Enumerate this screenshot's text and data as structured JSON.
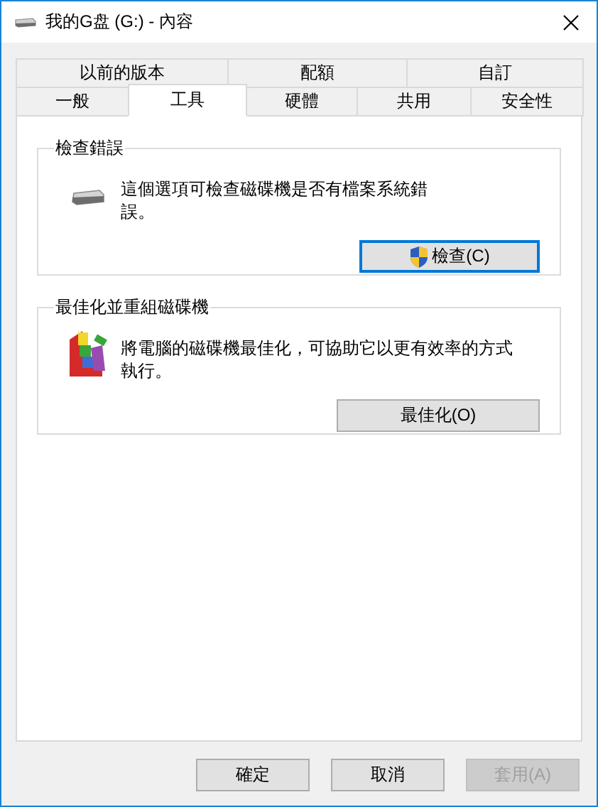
{
  "window": {
    "title": "我的G盘 (G:) - 內容"
  },
  "tab_rows": [
    [
      {
        "label": "以前的版本",
        "selected": false
      },
      {
        "label": "配額",
        "selected": false
      },
      {
        "label": "自訂",
        "selected": false
      }
    ],
    [
      {
        "label": "一般",
        "selected": false
      },
      {
        "label": "工具",
        "selected": true
      },
      {
        "label": "硬體",
        "selected": false
      },
      {
        "label": "共用",
        "selected": false
      },
      {
        "label": "安全性",
        "selected": false
      }
    ]
  ],
  "groups": [
    {
      "title": "檢查錯誤",
      "kind": "drive",
      "text": "這個選項可檢查磁碟機是否有檔案系統錯誤。",
      "button": {
        "label": "檢查(C)",
        "shield": true,
        "focused": true
      }
    },
    {
      "title": "最佳化並重組磁碟機",
      "kind": "defrag",
      "text": "將電腦的磁碟機最佳化，可協助它以更有效率的方式執行。",
      "button": {
        "label": "最佳化(O)",
        "shield": false,
        "focused": false
      }
    }
  ],
  "buttons": [
    {
      "label": "確定",
      "disabled": false
    },
    {
      "label": "取消",
      "disabled": false
    },
    {
      "label": "套用(A)",
      "disabled": true
    }
  ]
}
